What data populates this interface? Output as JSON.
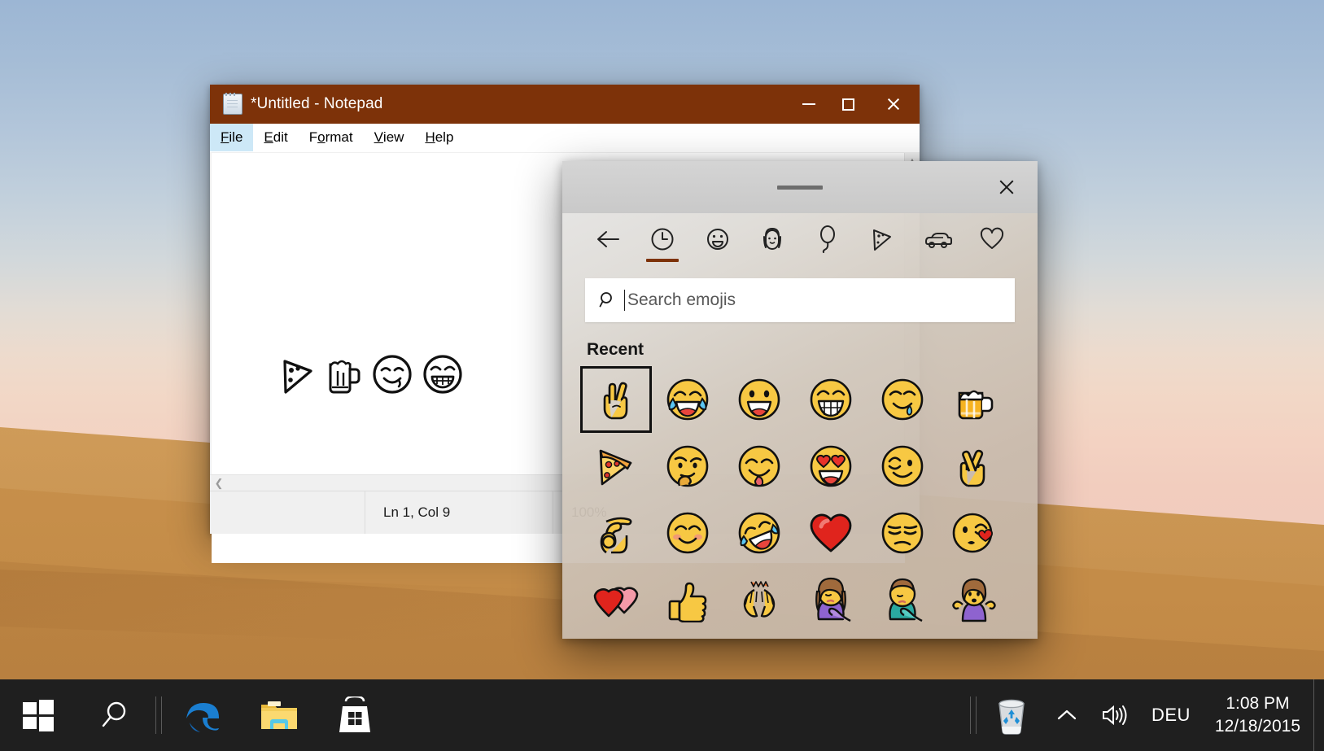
{
  "desktop": {
    "wallpaper_name": "desert-dune-wallpaper",
    "sky_top_color": "#9cb6d4",
    "sky_horizon_color": "#f0cbbd",
    "sand_color": "#cf9a55"
  },
  "notepad": {
    "title": "*Untitled - Notepad",
    "titlebar_color": "#7d3209",
    "icon": "notepad-icon",
    "controls": {
      "minimize": "minimize-button",
      "maximize": "maximize-button",
      "close": "close-button"
    },
    "menu": [
      {
        "label": "File",
        "accesskey": "F",
        "active": true
      },
      {
        "label": "Edit",
        "accesskey": "E",
        "active": false
      },
      {
        "label": "Format",
        "accesskey": "o",
        "active": false
      },
      {
        "label": "View",
        "accesskey": "V",
        "active": false
      },
      {
        "label": "Help",
        "accesskey": "H",
        "active": false
      }
    ],
    "document_text": "🍕🍺😋😁",
    "document_emojis": [
      "pizza",
      "beer-mug",
      "drooling-face",
      "beaming-face"
    ],
    "status": {
      "position": "Ln 1, Col 9",
      "zoom": "100%",
      "blank": ""
    },
    "scrollbars": {
      "vertical_up": "scroll-up-arrow",
      "horizontal_left": "scroll-left-arrow"
    }
  },
  "emoji_panel": {
    "grip": "drag-handle",
    "close": "close-button",
    "tabs": [
      {
        "name": "back",
        "icon": "back-arrow-icon",
        "active": false
      },
      {
        "name": "recent",
        "icon": "clock-icon",
        "active": true
      },
      {
        "name": "smileys",
        "icon": "smiley-face-icon",
        "active": false
      },
      {
        "name": "people",
        "icon": "person-icon",
        "active": false
      },
      {
        "name": "celebration",
        "icon": "balloon-icon",
        "active": false
      },
      {
        "name": "food",
        "icon": "pizza-slice-icon",
        "active": false
      },
      {
        "name": "transport",
        "icon": "car-icon",
        "active": false
      },
      {
        "name": "symbols",
        "icon": "heart-icon",
        "active": false
      }
    ],
    "active_tab_underline_color": "#7d3209",
    "search": {
      "placeholder": "Search emojis",
      "value": "",
      "icon": "search-icon"
    },
    "section_title": "Recent",
    "grid": [
      {
        "name": "victory-hand",
        "selected": true
      },
      {
        "name": "face-with-tears-of-joy",
        "selected": false
      },
      {
        "name": "grinning-face",
        "selected": false
      },
      {
        "name": "beaming-face",
        "selected": false
      },
      {
        "name": "drooling-face",
        "selected": false
      },
      {
        "name": "beer-mug",
        "selected": false
      },
      {
        "name": "pizza-slice",
        "selected": false
      },
      {
        "name": "thinking-face",
        "selected": false
      },
      {
        "name": "face-savoring-food",
        "selected": false
      },
      {
        "name": "smiling-face-heart-eyes",
        "selected": false
      },
      {
        "name": "winking-face",
        "selected": false
      },
      {
        "name": "crossed-fingers",
        "selected": false
      },
      {
        "name": "ok-hand",
        "selected": false
      },
      {
        "name": "smiling-face-blush",
        "selected": false
      },
      {
        "name": "rolling-on-floor-laughing",
        "selected": false
      },
      {
        "name": "red-heart",
        "selected": false
      },
      {
        "name": "unamused-face",
        "selected": false
      },
      {
        "name": "face-blowing-kiss",
        "selected": false
      },
      {
        "name": "revolving-hearts",
        "selected": false
      },
      {
        "name": "thumbs-up",
        "selected": false
      },
      {
        "name": "raising-hands",
        "selected": false
      },
      {
        "name": "woman-facepalming",
        "selected": false
      },
      {
        "name": "man-facepalming",
        "selected": false
      },
      {
        "name": "woman-shrugging",
        "selected": false
      }
    ]
  },
  "taskbar": {
    "background_color": "#1f1f1f",
    "buttons": [
      {
        "name": "start-button",
        "icon": "windows-logo-icon"
      },
      {
        "name": "search-button",
        "icon": "search-icon"
      },
      {
        "name": "edge-button",
        "icon": "edge-logo-icon"
      },
      {
        "name": "file-explorer-button",
        "icon": "folder-icon"
      },
      {
        "name": "microsoft-store-button",
        "icon": "store-bag-icon"
      }
    ],
    "tray": {
      "recycle_bin": "recycle-bin-icon",
      "show_hidden": "chevron-up-icon",
      "volume": "speaker-icon",
      "language": "DEU"
    },
    "clock": {
      "time": "1:08 PM",
      "date": "12/18/2015"
    }
  }
}
